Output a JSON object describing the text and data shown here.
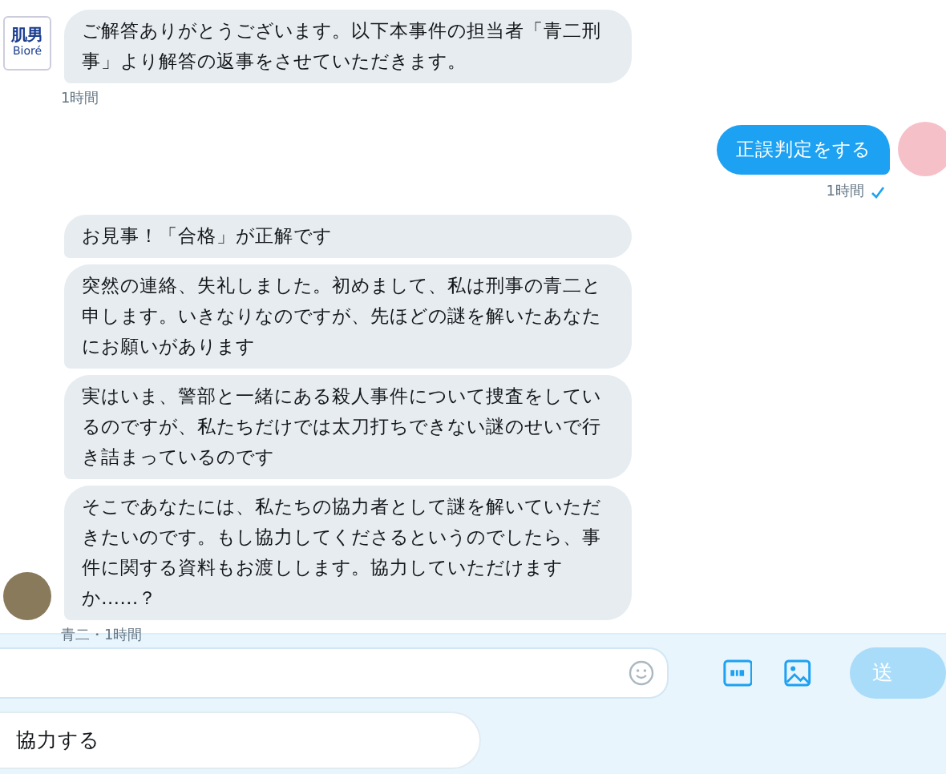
{
  "messages": [
    {
      "kind": "received",
      "avatar": {
        "kind": "logo",
        "line_1": "肌男",
        "line_2": "Bioré"
      },
      "bubbles": [
        "ご解答ありがとうございます。以下本事件の担当者「青二刑事」より解答の返事をさせていただきます。"
      ],
      "meta": "1時間",
      "read": false
    },
    {
      "kind": "sent",
      "avatar": {
        "kind": "character"
      },
      "bubbles": [
        "正誤判定をする"
      ],
      "meta": "1時間",
      "read": true
    },
    {
      "kind": "received",
      "avatar": {
        "kind": "person"
      },
      "bubbles": [
        "お見事！「合格」が正解です",
        "突然の連絡、失礼しました。初めまして、私は刑事の青二と申します。いきなりなのですが、先ほどの謎を解いたあなたにお願いがあります",
        "実はいま、警部と一緒にある殺人事件について捜査をしているのですが、私たちだけでは太刀打ちできない謎のせいで行き詰まっているのです",
        "そこであなたには、私たちの協力者として謎を解いていただきたいのです。もし協力してくださるというのでしたら、事件に関する資料もお渡しします。協力していただけますか……？"
      ],
      "meta": "青二・1時間",
      "read": false
    }
  ],
  "composer": {
    "send_label": "送"
  },
  "quick_replies": [
    "協力する"
  ]
}
